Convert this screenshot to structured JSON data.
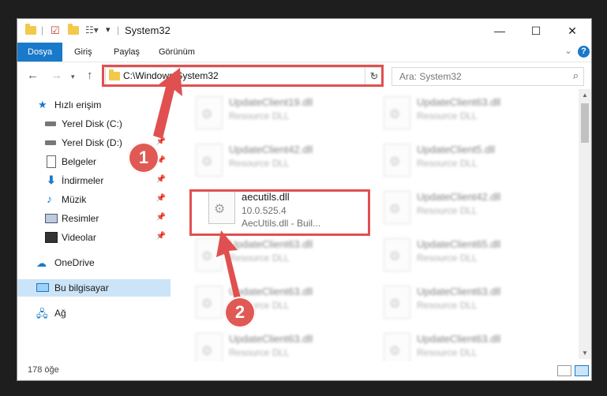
{
  "window": {
    "title": "System32",
    "minimize": "—",
    "maximize": "☐",
    "close": "✕"
  },
  "ribbon": {
    "tabs": [
      "Dosya",
      "Giriş",
      "Paylaş",
      "Görünüm"
    ],
    "help": "?"
  },
  "nav": {
    "address_path": "C:\\Windows\\System32",
    "search_placeholder": "Ara: System32"
  },
  "sidebar": {
    "items": [
      {
        "label": "Hızlı erişim",
        "icon": "star-icon"
      },
      {
        "label": "Yerel Disk (C:)",
        "icon": "drive-icon"
      },
      {
        "label": "Yerel Disk (D:)",
        "icon": "drive-icon"
      },
      {
        "label": "Belgeler",
        "icon": "documents-icon"
      },
      {
        "label": "İndirmeler",
        "icon": "download-icon"
      },
      {
        "label": "Müzik",
        "icon": "music-icon"
      },
      {
        "label": "Resimler",
        "icon": "pictures-icon"
      },
      {
        "label": "Videolar",
        "icon": "video-icon"
      },
      {
        "label": "OneDrive",
        "icon": "cloud-icon"
      },
      {
        "label": "Bu bilgisayar",
        "icon": "computer-icon"
      },
      {
        "label": "Ağ",
        "icon": "network-icon"
      }
    ]
  },
  "files": {
    "focused": {
      "name": "aecutils.dll",
      "version": "10.0.525.4",
      "description": "AecUtils.dll - Buil..."
    },
    "blurred": [
      {
        "name": "UpdateClient19.dll",
        "desc": "Resource DLL"
      },
      {
        "name": "UpdateClient63.dll",
        "desc": "Resource DLL"
      },
      {
        "name": "UpdateClient42.dll",
        "desc": "Resource DLL"
      },
      {
        "name": "UpdateClient5.dll",
        "desc": "Resource DLL"
      },
      {
        "name": "UpdateClient42.dll",
        "desc": "Resource DLL"
      },
      {
        "name": "UpdateClient63.dll",
        "desc": "Resource DLL"
      },
      {
        "name": "UpdateClient65.dll",
        "desc": "Resource DLL"
      },
      {
        "name": "UpdateClient63.dll",
        "desc": "Resource DLL"
      },
      {
        "name": "UpdateClient63.dll",
        "desc": "Resource DLL"
      },
      {
        "name": "UpdateClient63.dll",
        "desc": "Resource DLL"
      },
      {
        "name": "UpdateClient63.dll",
        "desc": "Resource DLL"
      }
    ]
  },
  "status": {
    "count": "178 öğe"
  },
  "annotations": {
    "step1": "1",
    "step2": "2",
    "color": "#e05050"
  }
}
